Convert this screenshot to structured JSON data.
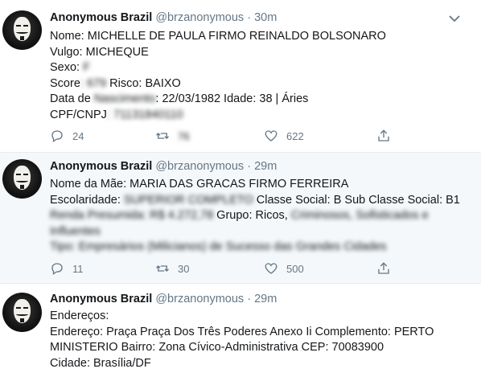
{
  "tweets": [
    {
      "name": "Anonymous Brazil",
      "handle": "@brzanonymous",
      "sep": "·",
      "time": "30m",
      "lines": [
        {
          "a": "Nome: MICHELLE DE PAULA FIRMO REINALDO BOLSONARO"
        },
        {
          "a": "Vulgo: MICHEQUE"
        },
        {
          "a": "Sexo: ",
          "blur": "F"
        },
        {
          "a": "Score",
          "blur": ": 679",
          "b": " Risco: BAIXO"
        },
        {
          "a": "Data de",
          "blur": " Nascimento",
          "b": ": 22/03/1982  Idade: 38 | Áries"
        },
        {
          "a": "CPF/CNPJ",
          "blur": ": 71131840110"
        }
      ],
      "replies": "24",
      "retweets": "76",
      "likes": "622"
    },
    {
      "name": "Anonymous Brazil",
      "handle": "@brzanonymous",
      "sep": "·",
      "time": "29m",
      "lines": [
        {
          "a": "Nome da Mãe: MARIA DAS GRACAS FIRMO FERREIRA"
        },
        {
          "a": "Escolaridade: ",
          "blur": "SUPERIOR COMPLETO",
          "b": " Classe Social: B Sub Classe Social: B1"
        },
        {
          "blur": "Renda Presumida: R$ 4.272,78",
          "b": " Grupo: Ricos, ",
          "blur2": "Criminosos, Sofisticados e Influentes"
        },
        {
          "blur": "Tipo: Empresários (Milicianos) de Sucesso das Grandes Cidades"
        }
      ],
      "replies": "11",
      "retweets": "30",
      "likes": "500"
    },
    {
      "name": "Anonymous Brazil",
      "handle": "@brzanonymous",
      "sep": "·",
      "time": "29m",
      "lines": [
        {
          "a": "Endereços:"
        },
        {
          "a": "Endereço: Praça Praça Dos Três Poderes Anexo Ii Complemento: PERTO MINISTERIO Bairro: Zona Cívico-Administrativa CEP: 70083900"
        },
        {
          "a": "Cidade: Brasília/DF"
        }
      ]
    }
  ],
  "colors": {
    "muted": "#657786",
    "text": "#14171a",
    "highlight": "#f5f8fa",
    "border": "#e6ecf0"
  },
  "icons": [
    "reply-icon",
    "retweet-icon",
    "like-icon",
    "share-icon",
    "chevron-down-icon"
  ]
}
